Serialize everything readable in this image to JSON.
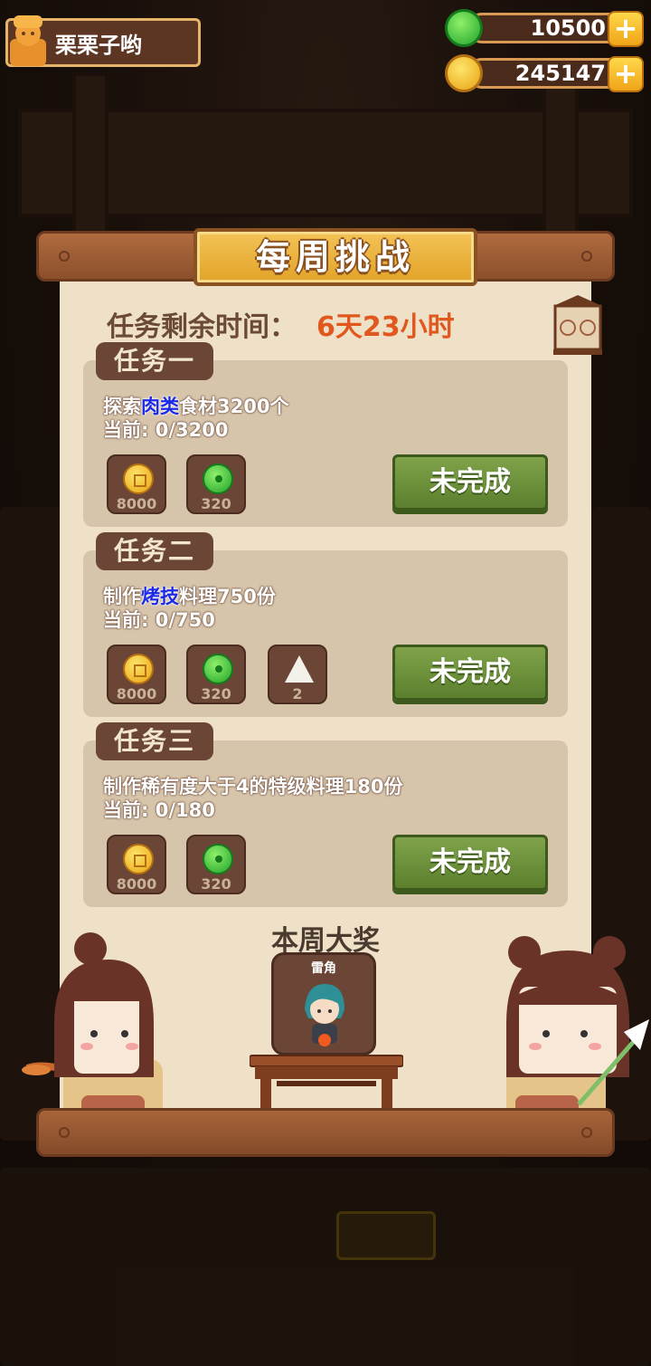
{
  "player": {
    "name": "栗栗子哟",
    "avatar_icon": "chef-avatar-icon"
  },
  "currencies": [
    {
      "name": "jade",
      "icon": "jade-icon",
      "value": "10500"
    },
    {
      "name": "coin",
      "icon": "coin-icon",
      "value": "245147"
    }
  ],
  "panel": {
    "title": "每周挑战",
    "timer_label": "任务剩余时间：",
    "timer_value": "6天23小时"
  },
  "tasks": [
    {
      "tag": "任务一",
      "desc_pre": "探索",
      "desc_hl": "肉类",
      "desc_post": "食材3200个",
      "progress": "当前: 0/3200",
      "rewards": [
        {
          "icon": "coin-icon",
          "amount": "8000"
        },
        {
          "icon": "jade-icon",
          "amount": "320"
        }
      ],
      "status": "未完成"
    },
    {
      "tag": "任务二",
      "desc_pre": "制作",
      "desc_hl": "烤技",
      "desc_post": "料理750份",
      "progress": "当前: 0/750",
      "rewards": [
        {
          "icon": "coin-icon",
          "amount": "8000"
        },
        {
          "icon": "jade-icon",
          "amount": "320"
        },
        {
          "icon": "rice-ball-icon",
          "amount": "2"
        }
      ],
      "status": "未完成"
    },
    {
      "tag": "任务三",
      "desc_pre": "制作稀有度大于4的特级料理180份",
      "desc_hl": "",
      "desc_post": "",
      "progress": "当前: 0/180",
      "rewards": [
        {
          "icon": "coin-icon",
          "amount": "8000"
        },
        {
          "icon": "jade-icon",
          "amount": "320"
        }
      ],
      "status": "未完成"
    }
  ],
  "prize": {
    "title": "本周大奖",
    "name": "雷角"
  },
  "colors": {
    "accent": "#e0581e",
    "highlight": "#1a2ae6",
    "button": "#6e9240"
  }
}
